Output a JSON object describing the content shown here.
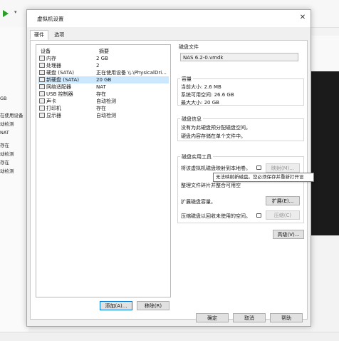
{
  "background": {
    "left_items": [
      "GB",
      "在使用设备",
      "动检测",
      "NAT",
      "存在",
      "动检测",
      "存在",
      "动检测"
    ]
  },
  "dialog": {
    "title": "虚拟机设置",
    "close_glyph": "✕",
    "tabs": [
      {
        "label": "硬件"
      },
      {
        "label": "选项"
      }
    ],
    "device_header": {
      "device": "设备",
      "summary": "摘要"
    },
    "devices": [
      {
        "name": "内存",
        "summary": "2 GB"
      },
      {
        "name": "处理器",
        "summary": "2"
      },
      {
        "name": "硬盘 (SATA)",
        "summary": "正在使用设备 \\\\.\\PhysicalDri..."
      },
      {
        "name": "新硬盘 (SATA)",
        "summary": "20 GB"
      },
      {
        "name": "网络适配器",
        "summary": "NAT"
      },
      {
        "name": "USB 控制器",
        "summary": "存在"
      },
      {
        "name": "声卡",
        "summary": "自动检测"
      },
      {
        "name": "打印机",
        "summary": "存在"
      },
      {
        "name": "显示器",
        "summary": "自动检测"
      }
    ],
    "add_button": "添加(A)...",
    "remove_button": "移除(R)",
    "disk_file": {
      "title": "磁盘文件",
      "value": "NAS 6.2-0.vmdk"
    },
    "capacity": {
      "title": "容量",
      "current": "当前大小: 2.6 MB",
      "free": "系统可用空间: 26.6 GB",
      "max": "最大大小: 20 GB"
    },
    "disk_info": {
      "title": "磁盘信息",
      "line1": "没有为此硬盘预分配磁盘空间。",
      "line2": "硬盘内容存储在单个文件中。"
    },
    "utilities": {
      "title": "磁盘实用工具",
      "map_text": "将该虚拟机磁盘映射到本地卷。",
      "map_button": "映射(M)...",
      "defrag_text": "整理文件碎片并整合可用空",
      "expand_text": "扩展磁盘容量。",
      "expand_button": "扩展(E)...",
      "compact_text": "压缩磁盘以回收未使用的空间。",
      "compact_button": "压缩(C)"
    },
    "tooltip": "无法映射新磁盘。您必须保存并重新打开设",
    "advanced_button": "高级(V)...",
    "ok_button": "确定",
    "cancel_button": "取消",
    "help_button": "帮助"
  }
}
